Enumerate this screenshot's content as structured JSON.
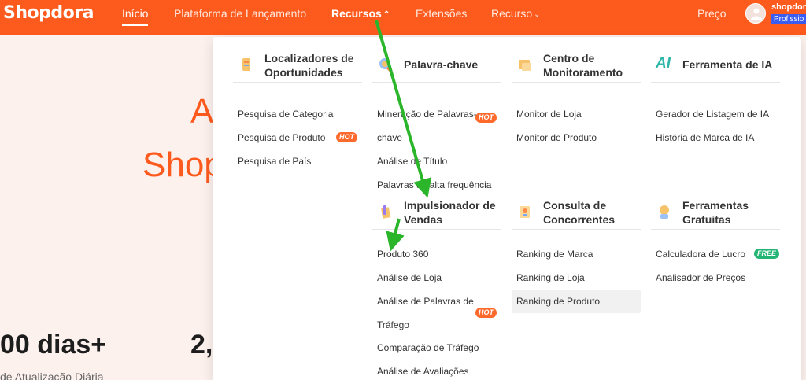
{
  "brand": {
    "logo": "Shopdora"
  },
  "nav": {
    "inicio": "Início",
    "plataforma": "Plataforma de Lançamento",
    "recursos": "Recursos",
    "extensoes": "Extensões",
    "recurso": "Recurso",
    "preco": "Preço"
  },
  "user": {
    "name": "shopdora",
    "plan": "Profissio"
  },
  "hero": {
    "line1": "A",
    "line2": "Shop"
  },
  "stats": [
    {
      "value": "00 dias+",
      "label": "de Atualização Diária"
    },
    {
      "value": "2,"
    }
  ],
  "categories": [
    {
      "title": "Localizadores de Oportunidades",
      "icon": "opportunity-icon",
      "items": [
        {
          "label": "Pesquisa de Categoria"
        },
        {
          "label": "Pesquisa de Produto",
          "badge": "HOT"
        },
        {
          "label": "Pesquisa de País"
        }
      ]
    },
    {
      "title": "Palavra-chave",
      "icon": "keyword-icon",
      "items": [
        {
          "label": "Mineração de Palavras-",
          "label2": "chave",
          "badge": "HOT"
        },
        {
          "label": "Análise de Título"
        },
        {
          "label": "Palavras de alta frequência"
        }
      ]
    },
    {
      "title": "Centro de Monitoramento",
      "icon": "monitor-icon",
      "items": [
        {
          "label": "Monitor de Loja"
        },
        {
          "label": "Monitor de Produto"
        }
      ]
    },
    {
      "title": "Ferramenta de IA",
      "icon": "ai-icon",
      "icon_text": "AI",
      "items": [
        {
          "label": "Gerador de Listagem de IA"
        },
        {
          "label": "História de Marca de IA"
        }
      ]
    },
    {
      "title": "Impulsionador de Vendas",
      "icon": "sales-booster-icon",
      "items": [
        {
          "label": "Produto 360"
        },
        {
          "label": "Análise de Loja"
        },
        {
          "label": "Análise de Palavras de",
          "label2": "Tráfego",
          "badge": "HOT"
        },
        {
          "label": "Comparação de Tráfego"
        },
        {
          "label": "Análise de Avaliações"
        }
      ]
    },
    {
      "title": "Consulta de Concorrentes",
      "icon": "competitor-icon",
      "items": [
        {
          "label": "Ranking de Marca"
        },
        {
          "label": "Ranking de Loja"
        },
        {
          "label": "Ranking de Produto"
        }
      ]
    },
    {
      "title": "Ferramentas Gratuitas",
      "icon": "free-tools-icon",
      "items": [
        {
          "label": "Calculadora de Lucro",
          "badge": "FREE"
        },
        {
          "label": "Analisador de Preços"
        }
      ]
    }
  ],
  "colors": {
    "brand": "#fd5a1e",
    "hot": "#fd6a2c",
    "free": "#22b573",
    "arrow": "#2bb52b"
  }
}
